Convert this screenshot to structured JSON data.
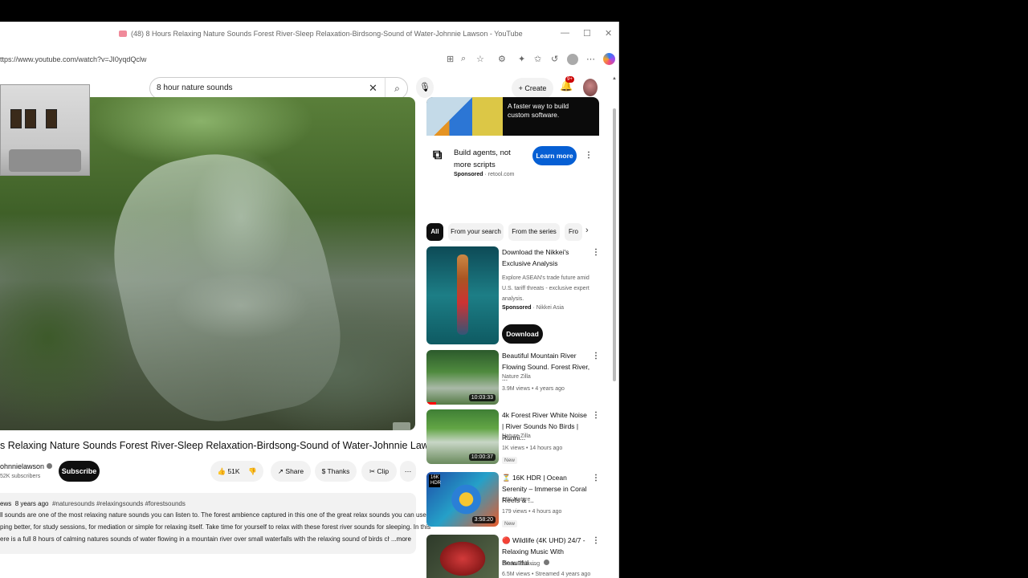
{
  "browser": {
    "tab_title": "(48) 8 Hours Relaxing Nature Sounds Forest River-Sleep Relaxation-Birdsong-Sound of Water-Johnnie Lawson - YouTube",
    "url": "ttps://www.youtube.com/watch?v=JI0yqdQclw",
    "window_controls": [
      "—",
      "☐",
      "✕"
    ]
  },
  "youtube": {
    "search_value": "8 hour nature sounds",
    "create_label": "Create",
    "notification_count": "9+"
  },
  "video": {
    "title": "s Relaxing Nature Sounds Forest River-Sleep Relaxation-Birdsong-Sound of Water-Johnnie Lawson",
    "channel": "ohnnielawson",
    "subscribers": "52K subscribers",
    "subscribe_label": "Subscribe",
    "likes": "51K",
    "share_label": "Share",
    "thanks_label": "Thanks",
    "clip_label": "Clip",
    "description": {
      "views": "ews",
      "age": "8 years ago",
      "tags": "#naturesounds #relaxingsounds #forestsounds",
      "lines": [
        "ll sounds are one of the most relaxing nature sounds you can listen to. The forest ambience captured in this one of the great relax sounds you can use",
        "ping better, for study sessions, for mediation or simple for relaxing itself. Take time for yourself to relax with these forest river sounds for sleeping. In this",
        "ere is a full 8 hours of calming natures sounds of water flowing in a mountain river over small waterfalls with the relaxing sound of birds chirping i"
      ],
      "more_label": "...more"
    }
  },
  "ad": {
    "banner_text": "A faster way to build custom software.",
    "headline": "Build agents, not more scripts",
    "sponsored": "Sponsored",
    "domain": "retool.com",
    "cta": "Learn more"
  },
  "chips": [
    "All",
    "From your search",
    "From the series",
    "Fro"
  ],
  "recommendations": [
    {
      "title": "Download the Nikkei's Exclusive Analysis",
      "desc": "Explore ASEAN's trade future amid U.S. tariff threats - exclusive expert analysis.",
      "sponsored": "Sponsored",
      "channel": "Nikkei Asia",
      "cta": "Download"
    },
    {
      "title": "Beautiful Mountain River Flowing Sound. Forest River, ...",
      "channel": "Nature Zilla",
      "meta": "3.9M views • 4 years ago",
      "duration": "10:03:33"
    },
    {
      "title": "4k Forest River White Noise | River Sounds No Birds | Runni...",
      "channel": "Nature Zilla",
      "meta": "1K views • 14 hours ago",
      "badge": "New",
      "duration": "10:00:37"
    },
    {
      "title": "⏳ 16K HDR | Ocean Serenity – Immerse in Coral Reefs & ...",
      "channel": "16K Nature",
      "meta": "179 views • 4 hours ago",
      "badge": "New",
      "duration": "3:58:20",
      "thumb_label": "16K HDR"
    },
    {
      "title": "🔴 Wildlife (4K UHD) 24/7 - Relaxing Music With Beautiful ...",
      "channel": "Piano Relaxing",
      "meta": "6.5M views • Streamed 4 years ago"
    }
  ],
  "colors": {
    "youtube_red": "#ff0000",
    "cta_blue": "#065fd4",
    "chip_bg": "#f2f2f2",
    "dark": "#0f0f0f"
  }
}
